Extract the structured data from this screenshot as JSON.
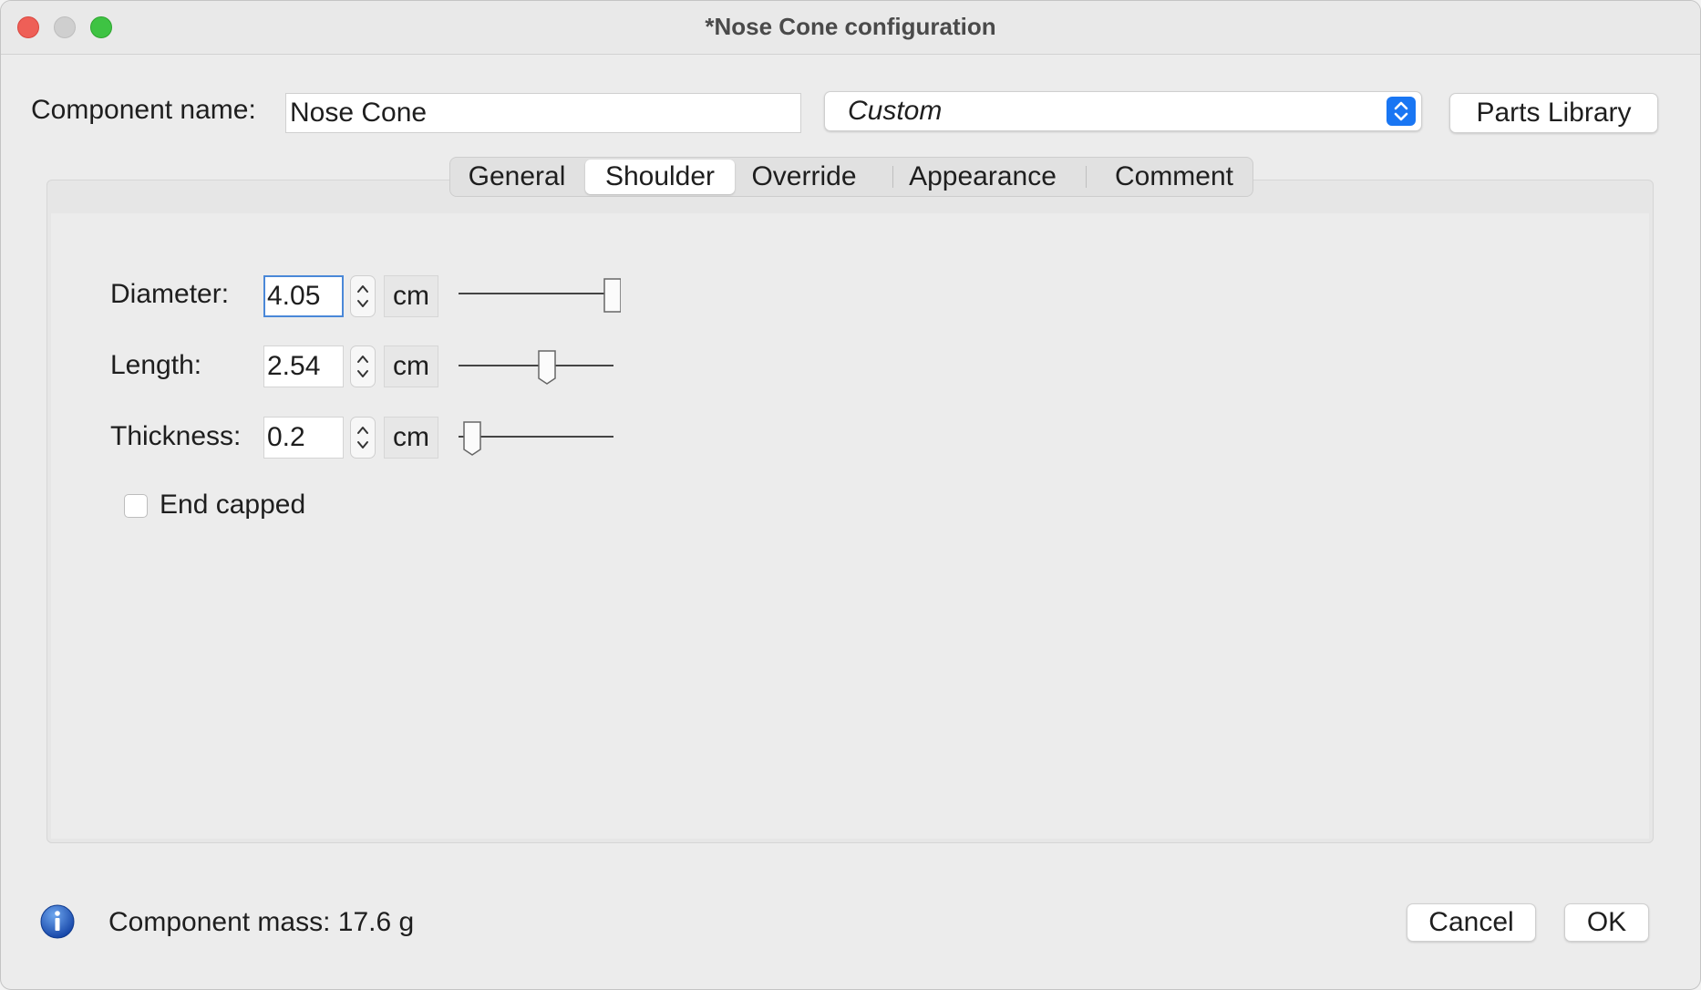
{
  "window": {
    "title": "*Nose Cone configuration"
  },
  "header": {
    "component_name_label": "Component name:",
    "component_name_value": "Nose Cone",
    "preset": "Custom",
    "parts_library_label": "Parts Library"
  },
  "tabs": [
    {
      "label": "General",
      "active": false
    },
    {
      "label": "Shoulder",
      "active": true
    },
    {
      "label": "Override",
      "active": false
    },
    {
      "label": "Appearance",
      "active": false
    },
    {
      "label": "Comment",
      "active": false
    }
  ],
  "shoulder": {
    "fields": [
      {
        "label": "Diameter:",
        "value": "4.05",
        "unit": "cm",
        "slider_fraction": 1.0
      },
      {
        "label": "Length:",
        "value": "2.54",
        "unit": "cm",
        "slider_fraction": 0.58
      },
      {
        "label": "Thickness:",
        "value": "0.2",
        "unit": "cm",
        "slider_fraction": 0.09
      }
    ],
    "end_capped": {
      "label": "End capped",
      "checked": false
    }
  },
  "footer": {
    "mass_text": "Component mass: 17.6 g",
    "cancel_label": "Cancel",
    "ok_label": "OK"
  },
  "icons": {
    "info": "info-icon",
    "select_arrows": "chevron-up-down-icon",
    "stepper": "stepper-arrows-icon"
  },
  "colors": {
    "accent": "#1976f3",
    "focus_ring": "#4a88d8",
    "close": "#ee5f57",
    "maximize": "#3ec343"
  }
}
